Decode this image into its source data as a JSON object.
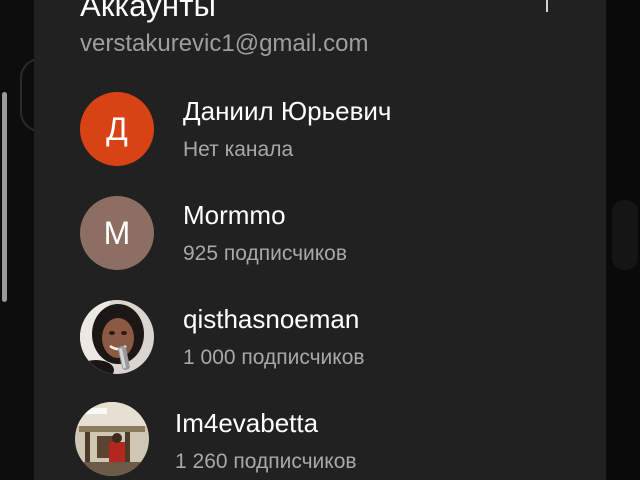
{
  "sheet": {
    "title": "Аккаунты",
    "current_email": "verstakurevic1@gmail.com"
  },
  "accounts": [
    {
      "name": "Даниил Юрьевич",
      "subtitle": "Нет канала",
      "avatar_letter": "Д",
      "avatar_color": "#d84315",
      "avatar_type": "letter"
    },
    {
      "name": "Mormmo",
      "subtitle": "925 подписчиков",
      "avatar_letter": "M",
      "avatar_color": "#8d6e63",
      "avatar_type": "letter"
    },
    {
      "name": "qisthasnoeman",
      "subtitle": "1 000 подписчиков",
      "avatar_type": "photo-portrait"
    },
    {
      "name": "Im4evabetta",
      "subtitle": "1 260 подписчиков",
      "avatar_type": "photo-scene"
    }
  ],
  "icons": {
    "more": "more-vert-icon"
  },
  "colors": {
    "sheet_background": "#212121",
    "primary_text": "#ffffff",
    "secondary_text": "#a8a8a8"
  }
}
